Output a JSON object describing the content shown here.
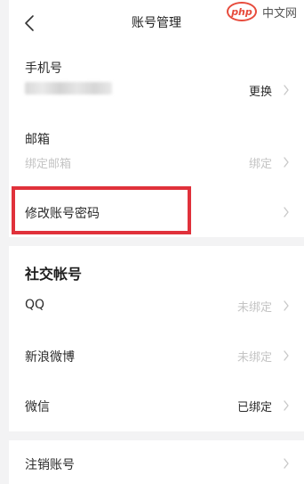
{
  "header": {
    "title": "账号管理",
    "back_icon": "chevron-left-icon"
  },
  "watermark": {
    "logo": "php",
    "text": "中文网"
  },
  "account": {
    "phone_label": "手机号",
    "phone_action": "更换",
    "email_label": "邮箱",
    "email_placeholder": "绑定邮箱",
    "email_action": "绑定",
    "change_password_label": "修改账号密码"
  },
  "social": {
    "title": "社交帐号",
    "items": [
      {
        "label": "QQ",
        "status": "未绑定"
      },
      {
        "label": "新浪微博",
        "status": "未绑定"
      },
      {
        "label": "微信",
        "status": "已绑定"
      }
    ]
  },
  "footer": {
    "cancel_account_label": "注销账号"
  },
  "colors": {
    "highlight_border": "#e0313b",
    "muted_text": "#c4c4c4",
    "background": "#f3f3f4"
  }
}
